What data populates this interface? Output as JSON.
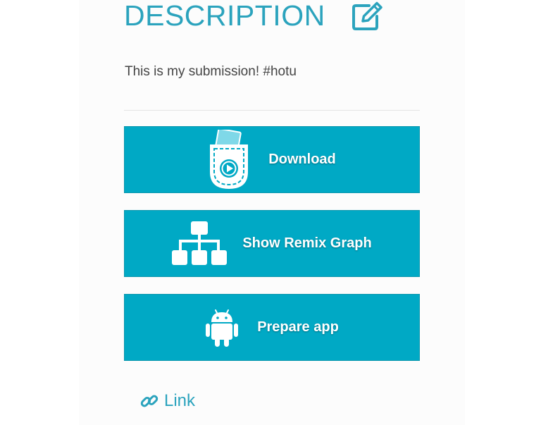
{
  "description": {
    "title": "DESCRIPTION",
    "text": "This is my submission! #hotu",
    "edit_icon": "edit-pencil-icon"
  },
  "actions": [
    {
      "label": "Download",
      "icon": "pocket-play-icon"
    },
    {
      "label": "Show Remix Graph",
      "icon": "hierarchy-icon"
    },
    {
      "label": "Prepare app",
      "icon": "android-icon"
    }
  ],
  "link": {
    "label": "Link",
    "icon": "chain-link-icon"
  },
  "colors": {
    "accent": "#2ba3bd",
    "button_bg": "#00a9c5",
    "text": "#444444"
  }
}
